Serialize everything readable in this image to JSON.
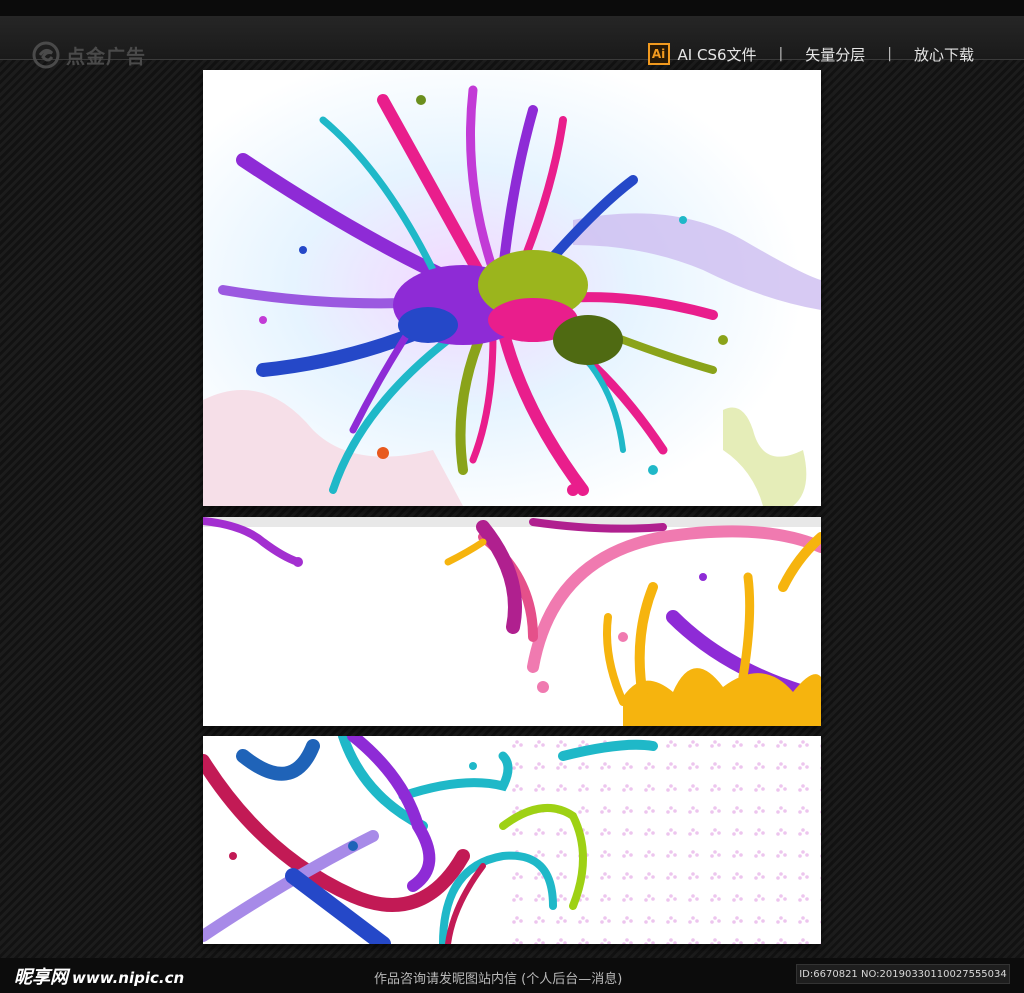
{
  "header": {
    "logo_text": "点金广告",
    "format_badge": "Ai",
    "format_label": "AI CS6文件",
    "separator": "|",
    "link_layers": "矢量分层",
    "link_download": "放心下载"
  },
  "footer": {
    "site_logo": "昵享网",
    "site_url": "www.nipic.cn",
    "contact_note": "作品咨询请发昵图站内信 (个人后台—消息)",
    "image_id": "ID:6670821 NO:20190330110027555034"
  },
  "colors": {
    "magenta": "#e91e8c",
    "purple": "#8e2bd6",
    "cyan": "#1fb8c8",
    "blue": "#2548c8",
    "olive": "#8aa31a",
    "yellow": "#f6b40e",
    "pink": "#f07ab0"
  },
  "icons": {
    "logo": "swirl-logo-icon",
    "ai_file": "ai-file-icon"
  }
}
